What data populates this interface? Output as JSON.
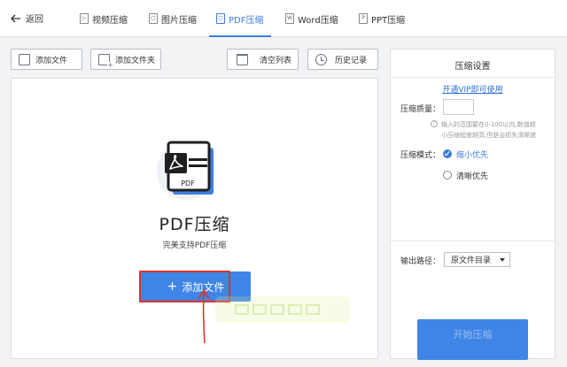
{
  "header": {
    "back_label": "返回",
    "tabs": [
      {
        "label": "视频压缩",
        "icon_char": "▷",
        "icon": "video-file-icon",
        "active": false
      },
      {
        "label": "图片压缩",
        "icon_char": "▢",
        "icon": "image-file-icon",
        "active": false
      },
      {
        "label": "PDF压缩",
        "icon_char": "▢",
        "icon": "pdf-file-icon",
        "active": true
      },
      {
        "label": "Word压缩",
        "icon_char": "W",
        "icon": "word-file-icon",
        "active": false
      },
      {
        "label": "PPT压缩",
        "icon_char": "P",
        "icon": "ppt-file-icon",
        "active": false
      }
    ]
  },
  "toolbar": {
    "add_file": "添加文件",
    "add_folder": "添加文件夹",
    "clear_list": "清空列表",
    "history": "历史记录"
  },
  "main": {
    "icon_text": "PDF",
    "title": "PDF压缩",
    "subtitle": "完美支持PDF压缩",
    "add_button": "添加文件",
    "add_button_plus": "+"
  },
  "settings": {
    "title": "压缩设置",
    "vip_link": "开通VIP即可使用",
    "quality_label": "压缩质量：",
    "quality_value": "",
    "hint_icon": "?",
    "hint_line1": "输入的范围要在0-100以内,数值越",
    "hint_line2": "小压缩程度越高,但是会损失清晰度",
    "mode_label": "压缩模式：",
    "mode_options": [
      {
        "label": "缩小优先",
        "selected": true
      },
      {
        "label": "清晰优先",
        "selected": false
      }
    ],
    "output_label": "输出路径：",
    "output_value": "原文件目录",
    "start_button": "开始压缩"
  },
  "colors": {
    "accent": "#3b7ddd",
    "primary_button": "#3f85e6",
    "highlight_box": "#e0312b",
    "link": "#2f6fd6"
  }
}
